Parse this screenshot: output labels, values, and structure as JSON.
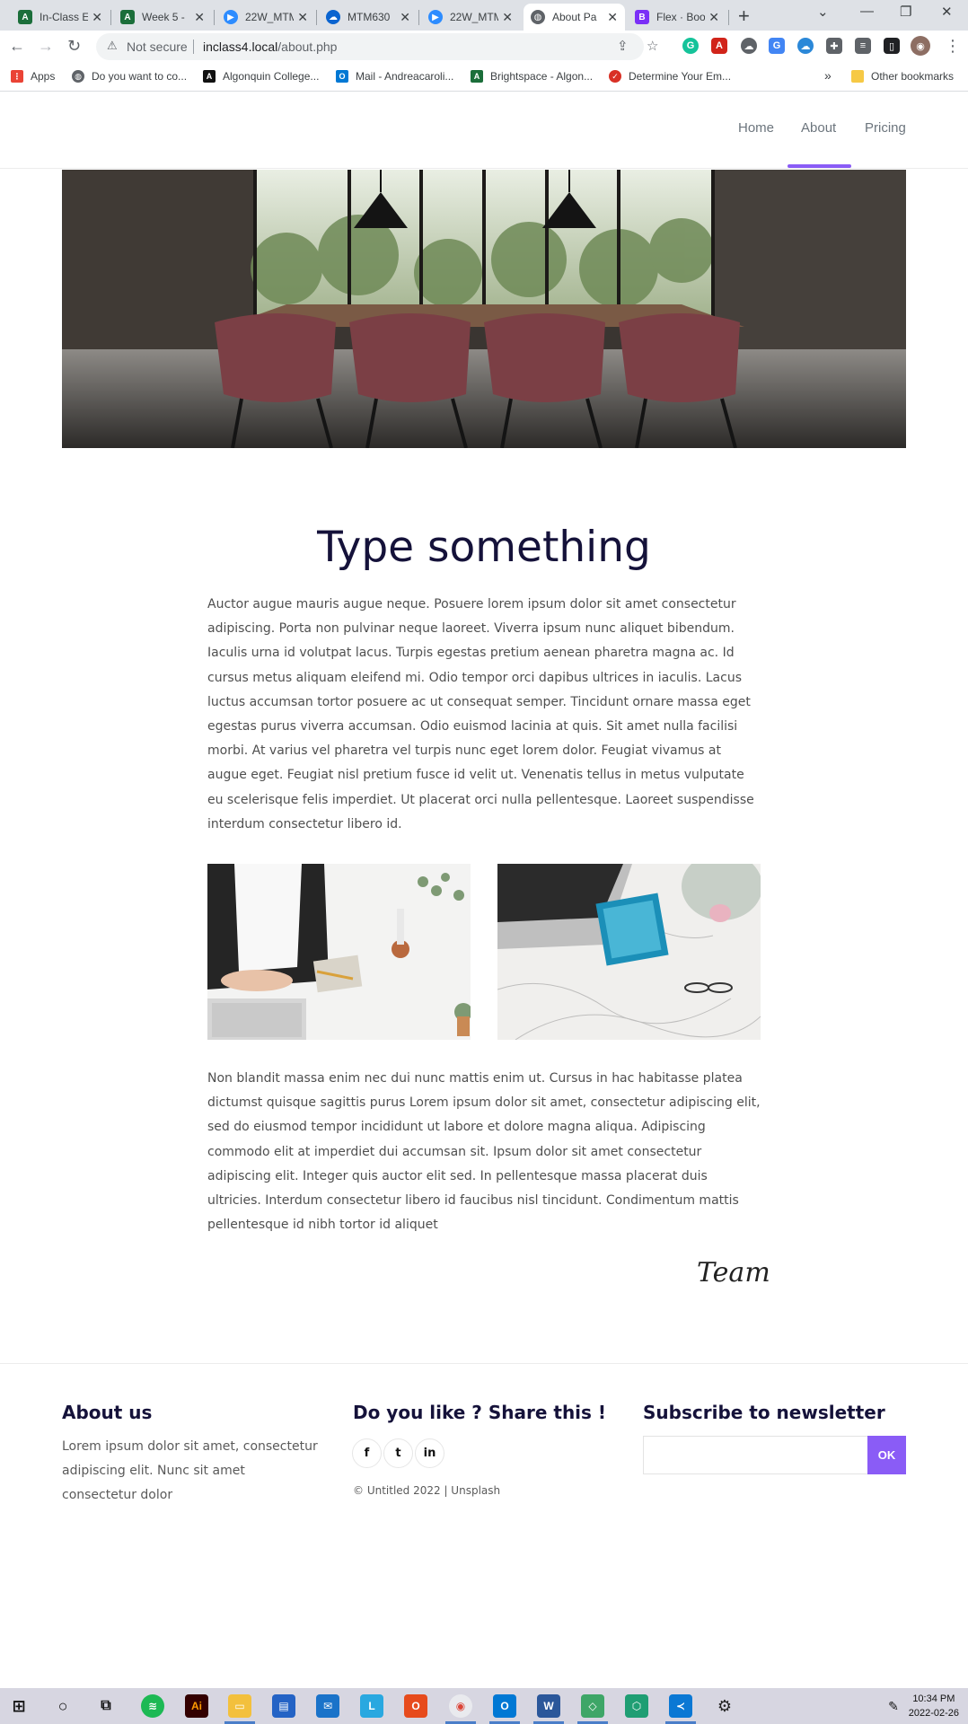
{
  "browser": {
    "tabs": [
      {
        "title": "In-Class E",
        "icon": "brightspace-icon"
      },
      {
        "title": "Week 5 -",
        "icon": "brightspace-icon"
      },
      {
        "title": "22W_MTM",
        "icon": "zoom-icon"
      },
      {
        "title": "MTM630",
        "icon": "onedrive-icon"
      },
      {
        "title": "22W_MTM",
        "icon": "zoom-icon"
      },
      {
        "title": "About Pa",
        "icon": "globe-icon"
      },
      {
        "title": "Flex · Boo",
        "icon": "bootstrap-icon"
      }
    ],
    "address": {
      "security": "Not secure",
      "host": "inclass4.local",
      "path": "/about.php"
    },
    "bookmarks": [
      {
        "label": "Apps"
      },
      {
        "label": "Do you want to co..."
      },
      {
        "label": "Algonquin College..."
      },
      {
        "label": "Mail - Andreacaroli..."
      },
      {
        "label": "Brightspace - Algon..."
      },
      {
        "label": "Determine Your Em..."
      }
    ],
    "bookmarks_more": "»",
    "other_bookmarks": "Other bookmarks"
  },
  "site": {
    "nav": [
      {
        "label": "Home"
      },
      {
        "label": "About"
      },
      {
        "label": "Pricing"
      }
    ],
    "active_nav": "About",
    "title": "Type something",
    "paragraph1": "Auctor augue mauris augue neque. Posuere lorem ipsum dolor sit amet consectetur adipiscing. Porta non pulvinar neque laoreet. Viverra ipsum nunc aliquet bibendum. Iaculis urna id volutpat lacus. Turpis egestas pretium aenean pharetra magna ac. Id cursus metus aliquam eleifend mi. Odio tempor orci dapibus ultrices in iaculis. Lacus luctus accumsan tortor posuere ac ut consequat semper. Tincidunt ornare massa eget egestas purus viverra accumsan. Odio euismod lacinia at quis. Sit amet nulla facilisi morbi. At varius vel pharetra vel turpis nunc eget lorem dolor. Feugiat vivamus at augue eget. Feugiat nisl pretium fusce id velit ut. Venenatis tellus in metus vulputate eu scelerisque felis imperdiet. Ut placerat orci nulla pellentesque. Laoreet suspendisse interdum consectetur libero id.",
    "paragraph2": "Non blandit massa enim nec dui nunc mattis enim ut. Cursus in hac habitasse platea dictumst quisque sagittis purus Lorem ipsum dolor sit amet, consectetur adipiscing elit, sed do eiusmod tempor incididunt ut labore et dolore magna aliqua. Adipiscing commodo elit at imperdiet dui accumsan sit. Ipsum dolor sit amet consectetur adipiscing elit. Integer quis auctor elit sed. In pellentesque massa placerat duis ultricies. Interdum consectetur libero id faucibus nisl tincidunt. Condimentum mattis pellentesque id nibh tortor id aliquet",
    "signature": "Team",
    "footer": {
      "about_heading": "About us",
      "about_text": "Lorem ipsum dolor sit amet, consectetur adipiscing elit. Nunc sit amet consectetur dolor",
      "share_heading": "Do you like ? Share this !",
      "social": [
        {
          "icon": "facebook-icon",
          "glyph": "f"
        },
        {
          "icon": "twitter-icon",
          "glyph": "t"
        },
        {
          "icon": "linkedin-icon",
          "glyph": "in"
        }
      ],
      "copyright": "© Untitled 2022 | Unsplash",
      "newsletter_heading": "Subscribe to newsletter",
      "newsletter_placeholder": "",
      "newsletter_button": "OK"
    },
    "accent_color": "#8a5cf6"
  },
  "taskbar": {
    "time": "10:34 PM",
    "date": "2022-02-26"
  }
}
